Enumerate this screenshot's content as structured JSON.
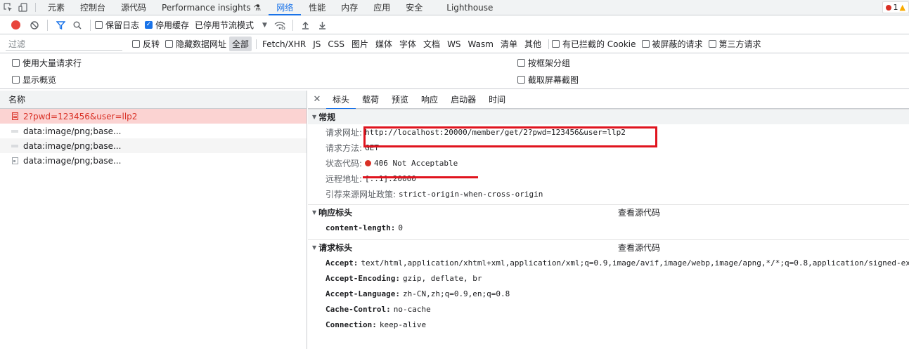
{
  "tabs": {
    "items": [
      "元素",
      "控制台",
      "源代码",
      "Performance insights",
      "网络",
      "性能",
      "内存",
      "应用",
      "安全",
      "Lighthouse"
    ],
    "active_index": 4,
    "error_count": "1"
  },
  "toolbar": {
    "preserve_log": "保留日志",
    "disable_cache": "停用缓存",
    "throttling": "已停用节流模式"
  },
  "filter": {
    "placeholder": "过滤",
    "invert": "反转",
    "hide_data_urls": "隐藏数据网址",
    "types": [
      "全部",
      "Fetch/XHR",
      "JS",
      "CSS",
      "图片",
      "媒体",
      "字体",
      "文档",
      "WS",
      "Wasm",
      "清单",
      "其他"
    ],
    "blocked_cookies": "有已拦截的 Cookie",
    "blocked_requests": "被屏蔽的请求",
    "third_party": "第三方请求"
  },
  "settings": {
    "large_rows": "使用大量请求行",
    "group_by_frame": "按框架分组",
    "overview": "显示概览",
    "screenshots": "截取屏幕截图"
  },
  "request_list": {
    "header": "名称",
    "items": [
      "2?pwd=123456&user=llp2",
      "data:image/png;base...",
      "data:image/png;base...",
      "data:image/png;base..."
    ]
  },
  "details": {
    "tabs": [
      "标头",
      "载荷",
      "预览",
      "响应",
      "启动器",
      "时间"
    ],
    "general": {
      "title": "常规",
      "url_label": "请求网址:",
      "url": "http://localhost:20000/member/get/2?pwd=123456&user=llp2",
      "method_label": "请求方法:",
      "method": "GET",
      "status_label": "状态代码:",
      "status": "406 Not Acceptable",
      "remote_label": "远程地址:",
      "remote": "[::1]:20000",
      "referrer_label": "引荐来源网址政策:",
      "referrer": "strict-origin-when-cross-origin"
    },
    "response_headers": {
      "title": "响应标头",
      "view_source": "查看源代码",
      "items": [
        {
          "k": "content-length:",
          "v": "0"
        }
      ]
    },
    "request_headers": {
      "title": "请求标头",
      "view_source": "查看源代码",
      "items": [
        {
          "k": "Accept:",
          "v": "text/html,application/xhtml+xml,application/xml;q=0.9,image/avif,image/webp,image/apng,*/*;q=0.8,application/signed-exc"
        },
        {
          "k": "Accept-Encoding:",
          "v": "gzip, deflate, br"
        },
        {
          "k": "Accept-Language:",
          "v": "zh-CN,zh;q=0.9,en;q=0.8"
        },
        {
          "k": "Cache-Control:",
          "v": "no-cache"
        },
        {
          "k": "Connection:",
          "v": "keep-alive"
        }
      ]
    }
  },
  "colors": {
    "accent": "#1a73e8",
    "error": "#d93025",
    "annotation": "#e0141e"
  }
}
